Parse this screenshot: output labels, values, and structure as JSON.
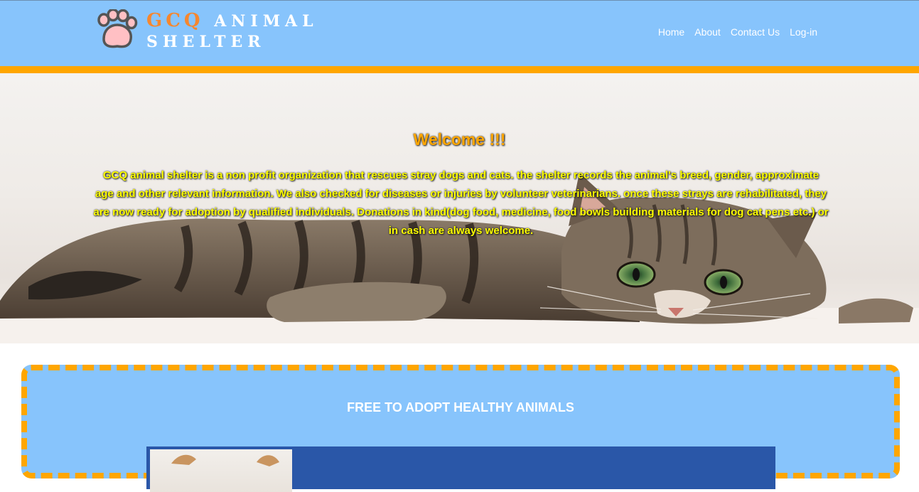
{
  "header": {
    "brand_line1_accent": "GCQ",
    "brand_line1_rest": "ANIMAL",
    "brand_line2": "SHELTER",
    "logo_icon": "paw-icon",
    "nav": [
      {
        "label": "Home"
      },
      {
        "label": "About"
      },
      {
        "label": "Contact Us"
      },
      {
        "label": "Log-in"
      }
    ]
  },
  "hero": {
    "heading": "Welcome !!!",
    "text": "GCQ animal shelter is a non profit organization that rescues stray dogs and cats. the shelter records the animal's breed, gender, approximate age and other relevant information. We also checked for diseases or injuries by volunteer veterinarians. once these strays are rehabilitated, they are now ready for adoption by qualified individuals. Donations in kind(dog food, medicine, food bowls building materials for dog cat pens etc.) or in cash are always welcome."
  },
  "adopt": {
    "title": "FREE TO ADOPT HEALTHY ANIMALS"
  },
  "colors": {
    "header_bg": "#87c4fc",
    "accent_orange": "#ffa600",
    "brand_orange": "#f5872f",
    "intro_yellow": "#ffff00",
    "card_blue": "#2a57a8"
  }
}
